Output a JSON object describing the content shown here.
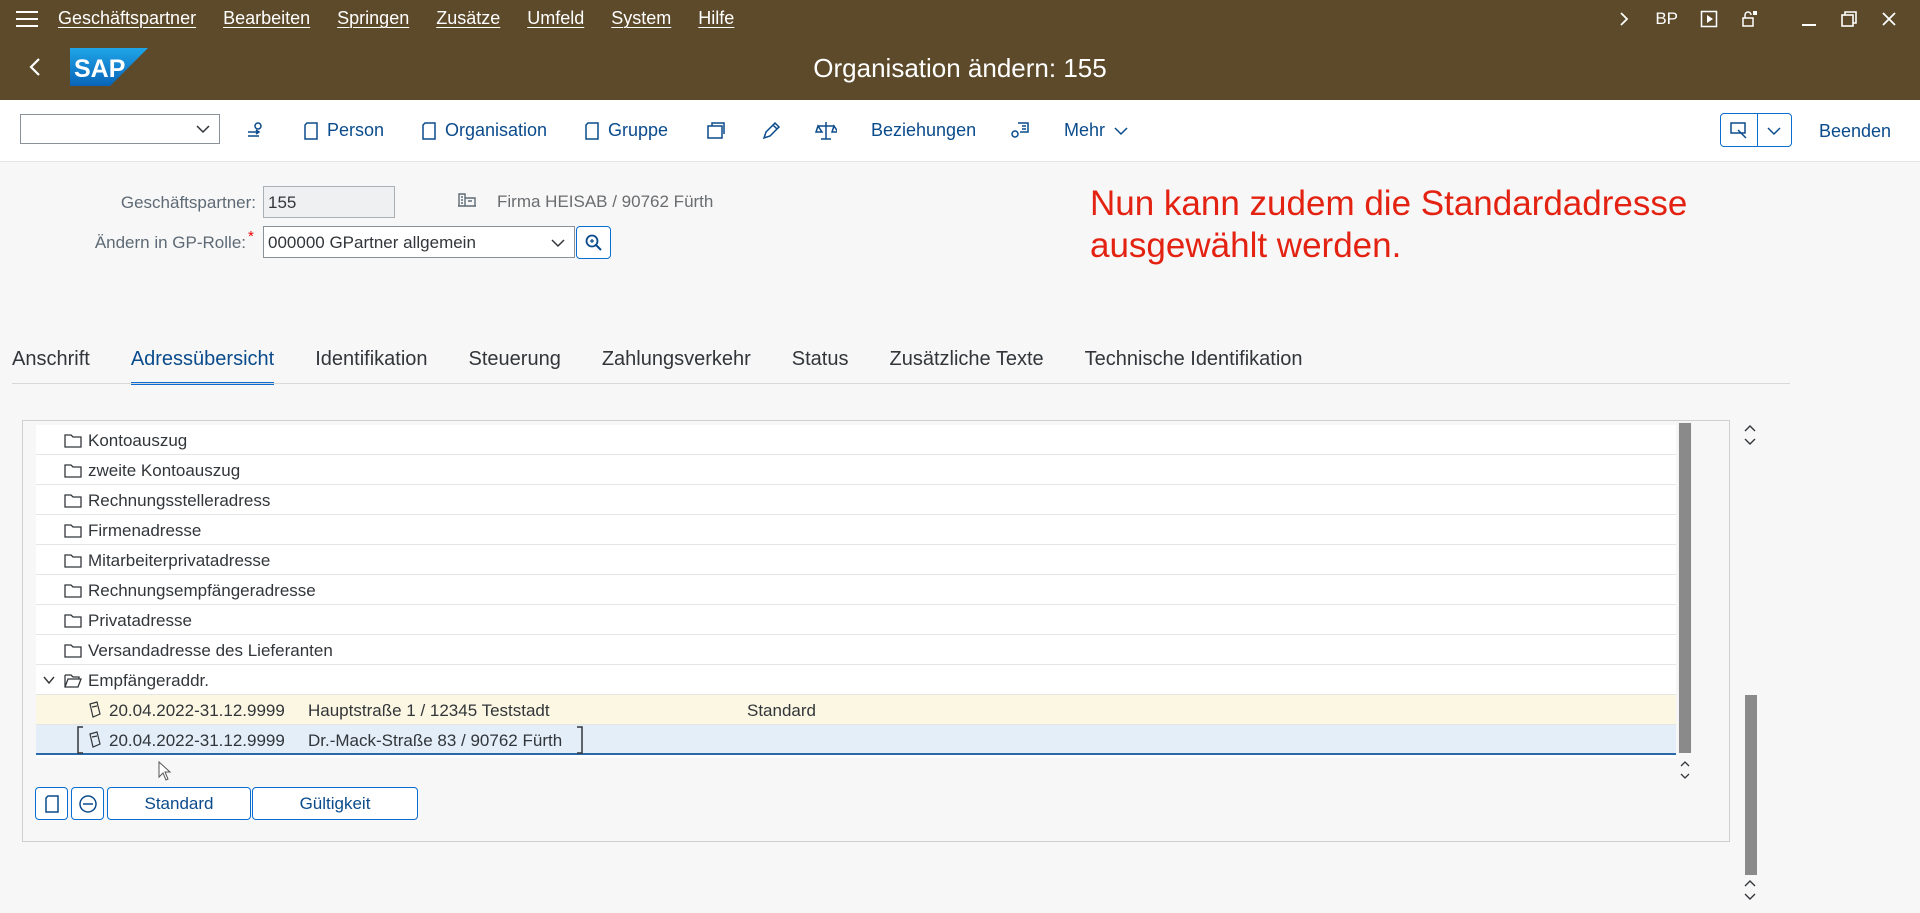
{
  "menubar": {
    "items": [
      "Geschäftspartner",
      "Bearbeiten",
      "Springen",
      "Zusätze",
      "Umfeld",
      "System",
      "Hilfe"
    ],
    "transaction": "BP"
  },
  "titlebar": {
    "title": "Organisation ändern: 155"
  },
  "toolbar": {
    "person": "Person",
    "organisation": "Organisation",
    "gruppe": "Gruppe",
    "beziehungen": "Beziehungen",
    "mehr": "Mehr",
    "beenden": "Beenden"
  },
  "header": {
    "partner_label": "Geschäftspartner:",
    "partner_value": "155",
    "company": "Firma HEISAB / 90762 Fürth",
    "role_label": "Ändern in GP-Rolle:",
    "role_value": "000000 GPartner allgemein"
  },
  "annotation": {
    "line1": "Nun kann zudem die Standardadresse",
    "line2": "ausgewählt werden."
  },
  "tabs": [
    "Anschrift",
    "Adressübersicht",
    "Identifikation",
    "Steuerung",
    "Zahlungsverkehr",
    "Status",
    "Zusätzliche Texte",
    "Technische Identifikation"
  ],
  "tree": {
    "folders": [
      "Kontoauszug",
      "zweite Kontoauszug",
      "Rechnungsstelleradress",
      "Firmenadresse",
      "Mitarbeiterprivatadresse",
      "Rechnungsempfängeradresse",
      "Privatadresse",
      "Versandadresse des Lieferanten"
    ],
    "open_folder": "Empfängeraddr.",
    "addresses": [
      {
        "validity": "20.04.2022-31.12.9999",
        "address": "Hauptstraße 1 / 12345 Teststadt",
        "flag": "Standard"
      },
      {
        "validity": "20.04.2022-31.12.9999",
        "address": "Dr.-Mack-Straße 83 / 90762 Fürth",
        "flag": ""
      }
    ]
  },
  "buttons": {
    "standard": "Standard",
    "gueltigkeit": "Gültigkeit"
  }
}
